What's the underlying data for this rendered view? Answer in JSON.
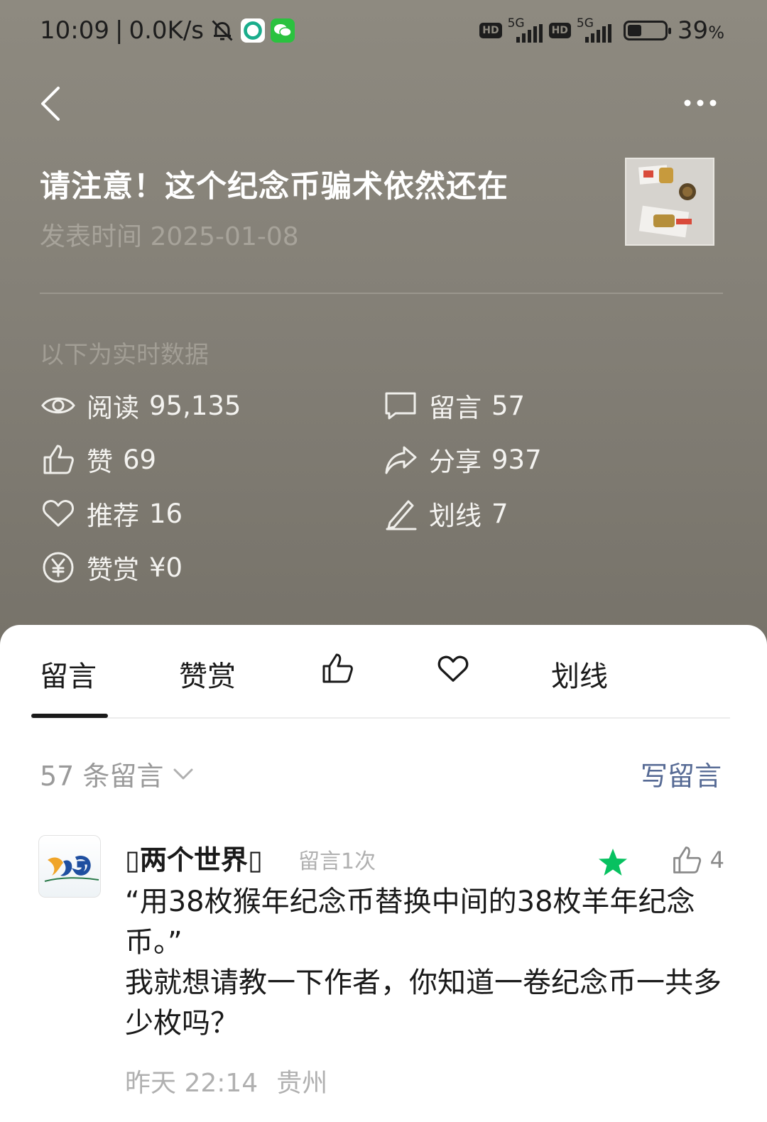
{
  "status_bar": {
    "time": "10:09",
    "net_speed": "0.0K/s",
    "net_type": "5G",
    "battery": "39",
    "battery_unit": "%"
  },
  "icons": {
    "back": "chevron-left-icon",
    "more": "more-dots-icon",
    "read": "eye-icon",
    "comment": "comment-bubble-icon",
    "like": "thumbs-up-icon",
    "share": "share-arrow-icon",
    "recommend": "heart-icon",
    "highlight": "pen-icon",
    "reward": "yuan-coin-icon",
    "comment_star": "star-icon"
  },
  "article": {
    "title": "请注意！这个纪念币骗术依然还在",
    "publish_time": "发表时间 2025-01-08"
  },
  "stats": {
    "heading": "以下为实时数据",
    "read_label": "阅读",
    "read_value": "95,135",
    "comment_label": "留言",
    "comment_value": "57",
    "like_label": "赞",
    "like_value": "69",
    "share_label": "分享",
    "share_value": "937",
    "recommend_label": "推荐",
    "recommend_value": "16",
    "highlight_label": "划线",
    "highlight_value": "7",
    "reward_label": "赞赏",
    "reward_value": "¥0"
  },
  "tabs": {
    "comments": "留言",
    "rewards": "赞赏",
    "highlights": "划线"
  },
  "comment_section": {
    "count_label": "57 条留言",
    "write_label": "写留言"
  },
  "comments": [
    {
      "nickname": "两个世界",
      "meta": "留言1次",
      "likes": "4",
      "text_line1": "“用38枚猴年纪念币替换中间的38枚羊年纪念币。”",
      "text_line2": "我就想请教一下作者，你知道一卷纪念币一共多少枚吗？",
      "time": "昨天 22:14",
      "location": "贵州"
    }
  ],
  "colors": {
    "header_bg": "#8e8a80",
    "link": "#576b95",
    "star": "#07c160"
  }
}
